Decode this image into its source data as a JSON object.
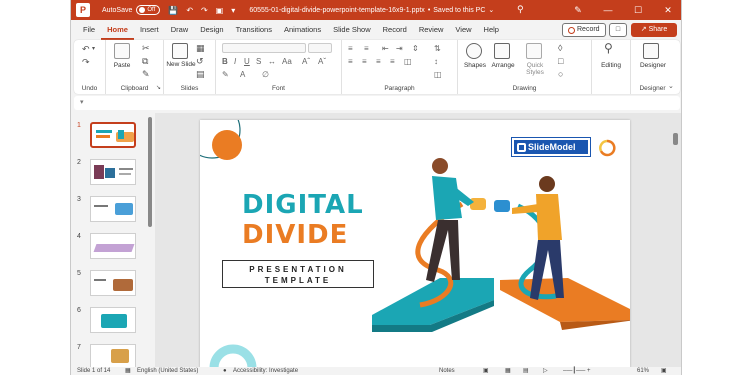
{
  "titlebar": {
    "autosave_label": "AutoSave",
    "autosave_state": "Off",
    "document_title": "60555-01-digital-divide-powerpoint-template-16x9-1.pptx",
    "save_status": "Saved to this PC",
    "accent": "#c43e1c"
  },
  "tabs": [
    {
      "label": "File"
    },
    {
      "label": "Home"
    },
    {
      "label": "Insert"
    },
    {
      "label": "Draw"
    },
    {
      "label": "Design"
    },
    {
      "label": "Transitions"
    },
    {
      "label": "Animations"
    },
    {
      "label": "Slide Show"
    },
    {
      "label": "Record"
    },
    {
      "label": "Review"
    },
    {
      "label": "View"
    },
    {
      "label": "Help"
    }
  ],
  "active_tab": "Home",
  "actions": {
    "record_label": "Record",
    "share_label": "Share"
  },
  "ribbon": {
    "groups": {
      "undo": "Undo",
      "clipboard": "Clipboard",
      "slides": "Slides",
      "font": "Font",
      "paragraph": "Paragraph",
      "drawing": "Drawing",
      "designer": "Designer"
    },
    "buttons": {
      "paste": "Paste",
      "new_slide": "New Slide",
      "shapes": "Shapes",
      "arrange": "Arrange",
      "quick_styles": "Quick Styles",
      "editing": "Editing",
      "designer": "Designer"
    }
  },
  "thumbnails": [
    {
      "num": "1",
      "selected": true
    },
    {
      "num": "2",
      "selected": false
    },
    {
      "num": "3",
      "selected": false
    },
    {
      "num": "4",
      "selected": false
    },
    {
      "num": "5",
      "selected": false
    },
    {
      "num": "6",
      "selected": false
    },
    {
      "num": "7",
      "selected": false
    }
  ],
  "slide": {
    "title_line1": "DIGITAL",
    "title_line2": "DIVIDE",
    "subtitle_line1": "PRESENTATION",
    "subtitle_line2": "TEMPLATE",
    "logo_text": "SlideModel",
    "colors": {
      "teal": "#1ba6b4",
      "orange": "#ea7c23",
      "logo_blue": "#1a56b0"
    }
  },
  "status": {
    "slide_count": "Slide 1 of 14",
    "language": "English (United States)",
    "accessibility": "Accessibility: Investigate",
    "notes": "Notes",
    "zoom": "61%"
  }
}
